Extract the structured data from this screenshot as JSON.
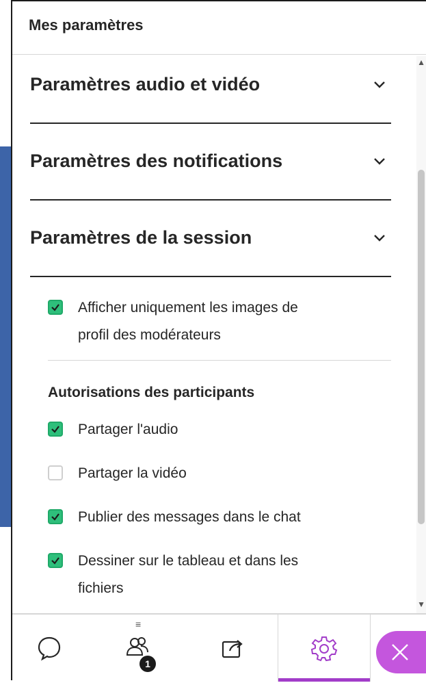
{
  "panel": {
    "title": "Mes paramètres"
  },
  "sections": [
    {
      "title": "Paramètres audio et vidéo",
      "expanded": false
    },
    {
      "title": "Paramètres des notifications",
      "expanded": false
    },
    {
      "title": "Paramètres de la session",
      "expanded": true
    }
  ],
  "session": {
    "profile_option": {
      "label_line1": "Afficher uniquement les images de",
      "label_line2": "profil des modérateurs",
      "checked": true
    },
    "permissions_title": "Autorisations des participants",
    "permissions": [
      {
        "label": "Partager l'audio",
        "checked": true
      },
      {
        "label": "Partager la vidéo",
        "checked": false
      },
      {
        "label": "Publier des messages dans le chat",
        "checked": true
      },
      {
        "label_line1": "Dessiner sur le tableau et dans les",
        "label_line2": "fichiers",
        "checked": true
      }
    ]
  },
  "bottom_nav": {
    "items": [
      {
        "icon": "chat-icon"
      },
      {
        "icon": "participants-icon",
        "badge": "1"
      },
      {
        "icon": "share-icon"
      },
      {
        "icon": "settings-icon",
        "selected": true
      },
      {
        "icon": "close-icon"
      }
    ]
  },
  "colors": {
    "accent": "#a23dc9",
    "checkbox": "#2ebf7b",
    "side_strip": "#3d64a8",
    "close_button": "#c456dd"
  }
}
